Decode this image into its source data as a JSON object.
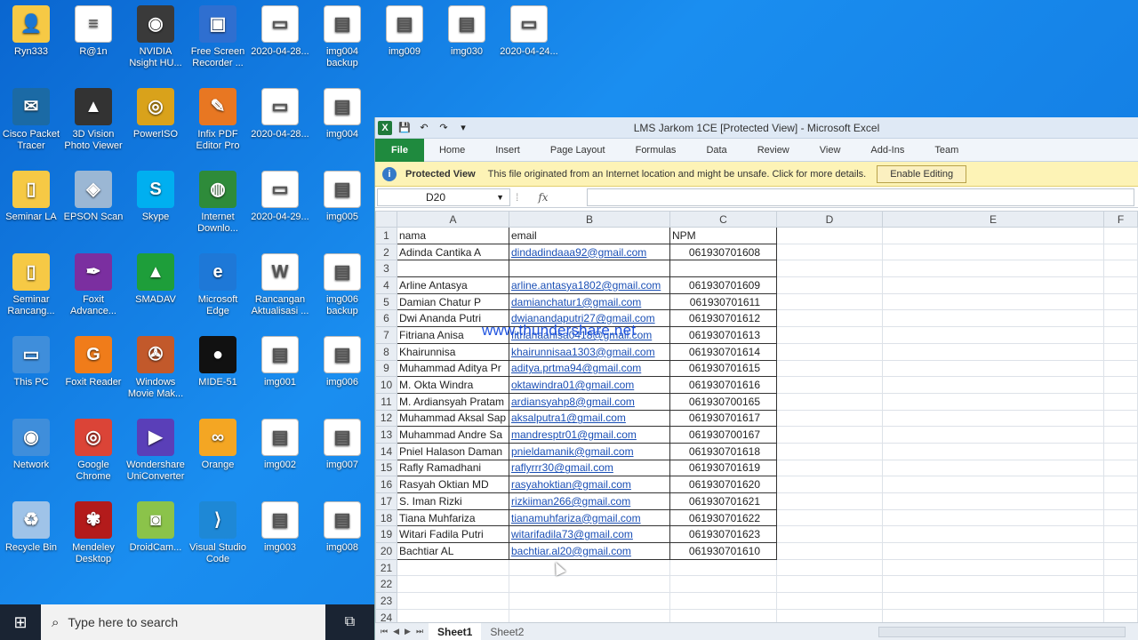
{
  "desktop_icons": [
    {
      "label": "Ryn333",
      "name": "user-folder-icon",
      "color": "#f6c945",
      "glyph": "👤"
    },
    {
      "label": "R@1n",
      "name": "document-icon",
      "color": "#ffffff",
      "glyph": "≡"
    },
    {
      "label": "NVIDIA Nsight HU...",
      "name": "nvidia-icon",
      "color": "#3a3a3a",
      "glyph": "◉"
    },
    {
      "label": "Free Screen Recorder ...",
      "name": "screen-recorder-icon",
      "color": "#2f6fd0",
      "glyph": "▣"
    },
    {
      "label": "2020-04-28...",
      "name": "screenshot-icon",
      "color": "#ffffff",
      "glyph": "▭"
    },
    {
      "label": "img004 backup",
      "name": "image-doc-icon",
      "color": "#ffffff",
      "glyph": "▤"
    },
    {
      "label": "img009",
      "name": "image-doc-icon",
      "color": "#ffffff",
      "glyph": "▤"
    },
    {
      "label": "img030",
      "name": "image-doc-icon",
      "color": "#ffffff",
      "glyph": "▤"
    },
    {
      "label": "2020-04-24...",
      "name": "screenshot-icon",
      "color": "#ffffff",
      "glyph": "▭"
    },
    {
      "label": "Cisco Packet Tracer",
      "name": "cisco-icon",
      "color": "#1b6aa5",
      "glyph": "✉"
    },
    {
      "label": "3D Vision Photo Viewer",
      "name": "3d-vision-icon",
      "color": "#333333",
      "glyph": "▲"
    },
    {
      "label": "PowerISO",
      "name": "poweriso-icon",
      "color": "#d9a21b",
      "glyph": "◎"
    },
    {
      "label": "Infix PDF Editor Pro",
      "name": "infix-pdf-icon",
      "color": "#e87722",
      "glyph": "✎"
    },
    {
      "label": "2020-04-28...",
      "name": "screenshot-icon",
      "color": "#ffffff",
      "glyph": "▭"
    },
    {
      "label": "img004",
      "name": "image-doc-icon",
      "color": "#ffffff",
      "glyph": "▤"
    },
    {
      "label": "Seminar LA",
      "name": "folder-icon",
      "color": "#f6c945",
      "glyph": "▯"
    },
    {
      "label": "EPSON Scan",
      "name": "epson-scan-icon",
      "color": "#9bb7d4",
      "glyph": "◈"
    },
    {
      "label": "Skype",
      "name": "skype-icon",
      "color": "#00aff0",
      "glyph": "S"
    },
    {
      "label": "Internet Downlo...",
      "name": "idm-icon",
      "color": "#2e8b3a",
      "glyph": "◍"
    },
    {
      "label": "2020-04-29...",
      "name": "screenshot-icon",
      "color": "#ffffff",
      "glyph": "▭"
    },
    {
      "label": "img005",
      "name": "image-doc-icon",
      "color": "#ffffff",
      "glyph": "▤"
    },
    {
      "label": "Seminar Rancang...",
      "name": "folder-icon",
      "color": "#f6c945",
      "glyph": "▯"
    },
    {
      "label": "Foxit Advance...",
      "name": "foxit-advance-icon",
      "color": "#7b2fa0",
      "glyph": "✒"
    },
    {
      "label": "SMADAV",
      "name": "smadav-icon",
      "color": "#1e9e3a",
      "glyph": "▲"
    },
    {
      "label": "Microsoft Edge",
      "name": "edge-icon",
      "color": "#1e78d7",
      "glyph": "e"
    },
    {
      "label": "Rancangan Aktualisasi ...",
      "name": "word-doc-icon",
      "color": "#ffffff",
      "glyph": "W"
    },
    {
      "label": "img006 backup",
      "name": "image-doc-icon",
      "color": "#ffffff",
      "glyph": "▤"
    },
    {
      "label": "This PC",
      "name": "this-pc-icon",
      "color": "#3f8edb",
      "glyph": "▭"
    },
    {
      "label": "Foxit Reader",
      "name": "foxit-reader-icon",
      "color": "#f07c1a",
      "glyph": "G"
    },
    {
      "label": "Windows Movie Mak...",
      "name": "movie-maker-icon",
      "color": "#c2592b",
      "glyph": "✇"
    },
    {
      "label": "MIDE-51",
      "name": "mide51-icon",
      "color": "#111111",
      "glyph": "●"
    },
    {
      "label": "img001",
      "name": "image-doc-icon",
      "color": "#ffffff",
      "glyph": "▤"
    },
    {
      "label": "img006",
      "name": "image-doc-icon",
      "color": "#ffffff",
      "glyph": "▤"
    },
    {
      "label": "Network",
      "name": "network-icon",
      "color": "#3f8edb",
      "glyph": "◉"
    },
    {
      "label": "Google Chrome",
      "name": "chrome-icon",
      "color": "#db4437",
      "glyph": "◎"
    },
    {
      "label": "Wondershare UniConverter",
      "name": "uniconverter-icon",
      "color": "#5a3fb8",
      "glyph": "▶"
    },
    {
      "label": "Orange",
      "name": "orange-icon",
      "color": "#f4a623",
      "glyph": "∞"
    },
    {
      "label": "img002",
      "name": "image-doc-icon",
      "color": "#ffffff",
      "glyph": "▤"
    },
    {
      "label": "img007",
      "name": "image-doc-icon",
      "color": "#ffffff",
      "glyph": "▤"
    },
    {
      "label": "Recycle Bin",
      "name": "recycle-bin-icon",
      "color": "#9fc3e8",
      "glyph": "♻"
    },
    {
      "label": "Mendeley Desktop",
      "name": "mendeley-icon",
      "color": "#b31b1b",
      "glyph": "✾"
    },
    {
      "label": "DroidCam...",
      "name": "droidcam-icon",
      "color": "#8bc34a",
      "glyph": "◙"
    },
    {
      "label": "Visual Studio Code",
      "name": "vscode-icon",
      "color": "#1e88d6",
      "glyph": "⟩"
    },
    {
      "label": "img003",
      "name": "image-doc-icon",
      "color": "#ffffff",
      "glyph": "▤"
    },
    {
      "label": "img008",
      "name": "image-doc-icon",
      "color": "#ffffff",
      "glyph": "▤"
    }
  ],
  "excel": {
    "title": "LMS Jarkom 1CE  [Protected View] - Microsoft Excel",
    "tabs": [
      "File",
      "Home",
      "Insert",
      "Page Layout",
      "Formulas",
      "Data",
      "Review",
      "View",
      "Add-Ins",
      "Team"
    ],
    "protected_view": {
      "title": "Protected View",
      "message": "This file originated from an Internet location and might be unsafe. Click for more details.",
      "button": "Enable Editing"
    },
    "name_box": "D20",
    "fx": "fx",
    "columns": [
      "A",
      "B",
      "C",
      "D",
      "E",
      "F"
    ],
    "rows": [
      {
        "num": "1",
        "a": "nama",
        "b": "email",
        "c": "NPM"
      },
      {
        "num": "2",
        "a": "Adinda Cantika A",
        "b": "dindadindaaa92@gmail.com",
        "c": "061930701608"
      },
      {
        "num": "3",
        "a": "",
        "b": "",
        "c": ""
      },
      {
        "num": "4",
        "a": "Arline Antasya",
        "b": "arline.antasya1802@gmail.com",
        "c": "061930701609"
      },
      {
        "num": "5",
        "a": "Damian Chatur P",
        "b": "damianchatur1@gmail.com",
        "c": "061930701611"
      },
      {
        "num": "6",
        "a": "Dwi Ananda Putri",
        "b": "dwianandaputri27@gmail.com",
        "c": "061930701612"
      },
      {
        "num": "7",
        "a": "Fitriana Anisa",
        "b": "fitrianaanisa0418@gmail.com",
        "c": "061930701613"
      },
      {
        "num": "8",
        "a": "Khairunnisa",
        "b": "khairunnisaa1303@gmail.com",
        "c": "061930701614"
      },
      {
        "num": "9",
        "a": "Muhammad Aditya Pr",
        "b": "aditya.prtma94@gmail.com",
        "c": "061930701615"
      },
      {
        "num": "10",
        "a": "M. Okta Windra",
        "b": "oktawindra01@gmail.com",
        "c": "061930701616"
      },
      {
        "num": "11",
        "a": "M. Ardiansyah Pratam",
        "b": "ardiansyahp8@gmail.com",
        "c": "061930700165"
      },
      {
        "num": "12",
        "a": "Muhammad Aksal Sap",
        "b": "aksalputra1@gmail.com",
        "c": "061930701617"
      },
      {
        "num": "13",
        "a": "Muhammad Andre Sa",
        "b": "mandresptr01@gmail.com",
        "c": "061930700167"
      },
      {
        "num": "14",
        "a": "Pniel Halason Daman",
        "b": "pnieldamanik@gmail.com",
        "c": "061930701618"
      },
      {
        "num": "15",
        "a": "Rafly Ramadhani",
        "b": "raflyrrr30@gmail.com",
        "c": "061930701619"
      },
      {
        "num": "16",
        "a": "Rasyah Oktian MD",
        "b": "rasyahoktian@gmail.com",
        "c": "061930701620"
      },
      {
        "num": "17",
        "a": "S. Iman Rizki",
        "b": "rizkiiman266@gmail.com",
        "c": "061930701621"
      },
      {
        "num": "18",
        "a": "Tiana Muhfariza",
        "b": "tianamuhfariza@gmail.com",
        "c": "061930701622"
      },
      {
        "num": "19",
        "a": "Witari Fadila Putri",
        "b": "witarifadila73@gmail.com",
        "c": "061930701623"
      },
      {
        "num": "20",
        "a": "Bachtiar AL",
        "b": "bachtiar.al20@gmail.com",
        "c": "061930701610"
      },
      {
        "num": "21",
        "a": "",
        "b": "",
        "c": ""
      },
      {
        "num": "22",
        "a": "",
        "b": "",
        "c": ""
      },
      {
        "num": "23",
        "a": "",
        "b": "",
        "c": ""
      },
      {
        "num": "24",
        "a": "",
        "b": "",
        "c": ""
      }
    ],
    "sheets": [
      "Sheet1",
      "Sheet2"
    ],
    "watermark": "www.thundershare.net"
  },
  "taskbar": {
    "search_placeholder": "Type here to search"
  }
}
